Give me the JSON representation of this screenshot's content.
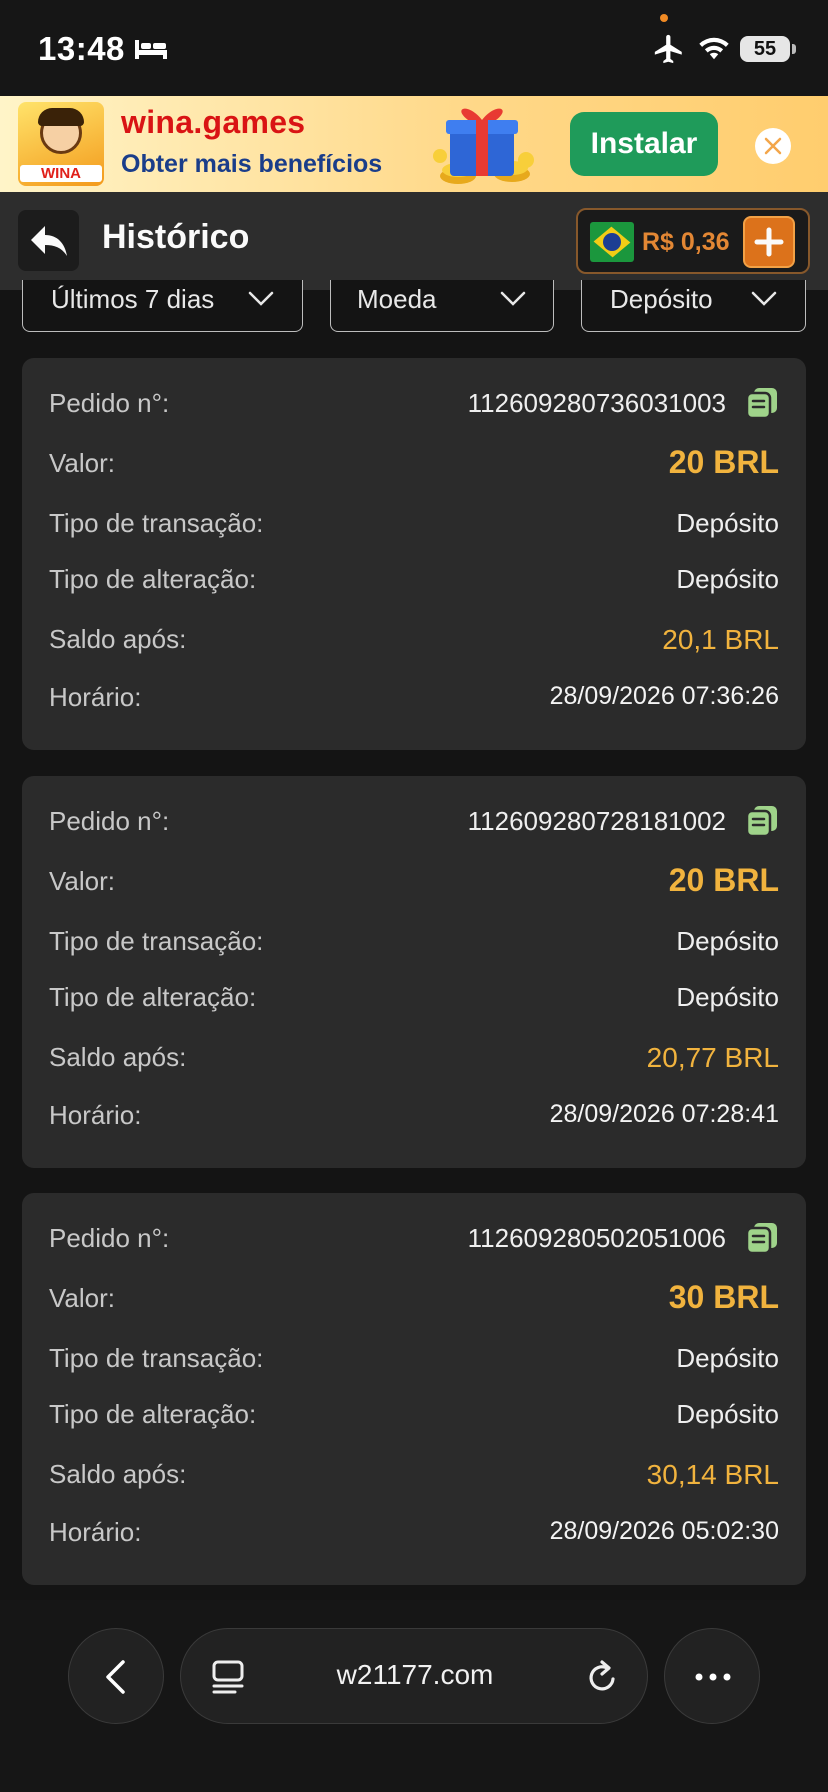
{
  "status_bar": {
    "time": "13:48",
    "battery": "55"
  },
  "banner": {
    "logo_text": "WINA",
    "title": "wina.games",
    "subtitle": "Obter mais benefícios",
    "install_label": "Instalar"
  },
  "header": {
    "title": "Histórico",
    "balance": "R$ 0,36"
  },
  "filters": [
    {
      "label": "Últimos 7 dias"
    },
    {
      "label": "Moeda"
    },
    {
      "label": "Depósito"
    }
  ],
  "labels": {
    "order": "Pedido n°:",
    "value": "Valor:",
    "transaction_type": "Tipo de transação:",
    "change_type": "Tipo de alteração:",
    "balance_after": "Saldo após:",
    "time": "Horário:"
  },
  "orders": [
    {
      "order_no": "112609280736031003",
      "amount": "20 BRL",
      "transaction_type": "Depósito",
      "change_type": "Depósito",
      "balance_after": "20,1 BRL",
      "time": "28/09/2026 07:36:26"
    },
    {
      "order_no": "112609280728181002",
      "amount": "20 BRL",
      "transaction_type": "Depósito",
      "change_type": "Depósito",
      "balance_after": "20,77 BRL",
      "time": "28/09/2026 07:28:41"
    },
    {
      "order_no": "112609280502051006",
      "amount": "30 BRL",
      "transaction_type": "Depósito",
      "change_type": "Depósito",
      "balance_after": "30,14 BRL",
      "time": "28/09/2026 05:02:30"
    }
  ],
  "browser": {
    "url": "w21177.com"
  },
  "colors": {
    "accent_orange": "#e0741c",
    "amount_gold": "#f1b33e",
    "install_green": "#1f9b5a",
    "copy_green": "#9fd38a"
  }
}
